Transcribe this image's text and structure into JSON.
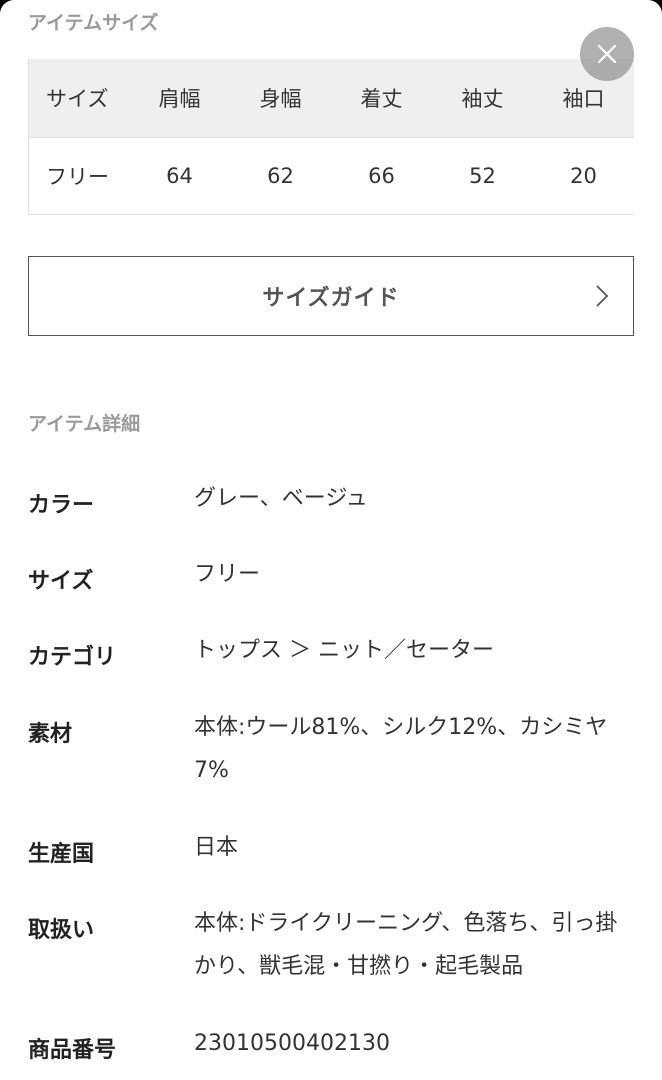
{
  "item_size": {
    "section_title": "アイテムサイズ",
    "columns": [
      "サイズ",
      "肩幅",
      "身幅",
      "着丈",
      "袖丈",
      "袖口"
    ],
    "rows": [
      [
        "フリー",
        "64",
        "62",
        "66",
        "52",
        "20"
      ]
    ]
  },
  "size_guide": {
    "label": "サイズガイド"
  },
  "item_details": {
    "section_title": "アイテム詳細",
    "rows": [
      {
        "key": "カラー",
        "value": "グレー、ベージュ"
      },
      {
        "key": "サイズ",
        "value": "フリー"
      },
      {
        "key": "カテゴリ",
        "value": "トップス ＞ ニット／セーター"
      },
      {
        "key": "素材",
        "value": "本体:ウール81%、シルク12%、カシミヤ7%"
      },
      {
        "key": "生産国",
        "value": "日本"
      },
      {
        "key": "取扱い",
        "value": "本体:ドライクリーニング、色落ち、引っ掛かり、獣毛混・甘撚り・起毛製品"
      },
      {
        "key": "商品番号",
        "value": "23010500402130"
      }
    ]
  },
  "icons": {
    "close": "close-icon",
    "chevron": "chevron-right-icon"
  }
}
